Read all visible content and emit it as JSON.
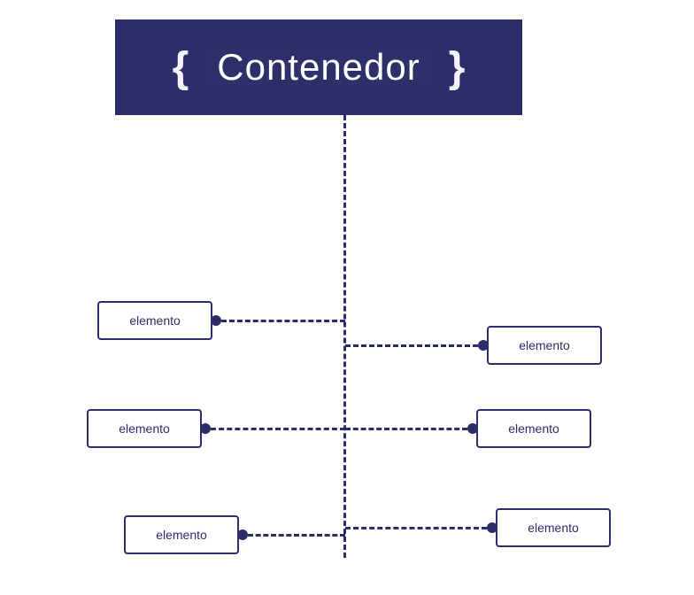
{
  "diagram": {
    "container": {
      "brace_open": "{",
      "title": "Contenedor",
      "brace_close": "}"
    },
    "elements": {
      "left": [
        {
          "label": "elemento"
        },
        {
          "label": "elemento"
        },
        {
          "label": "elemento"
        }
      ],
      "right": [
        {
          "label": "elemento"
        },
        {
          "label": "elemento"
        },
        {
          "label": "elemento"
        }
      ]
    },
    "colors": {
      "primary": "#2b2d66",
      "text_on_primary": "#ffffff"
    }
  }
}
